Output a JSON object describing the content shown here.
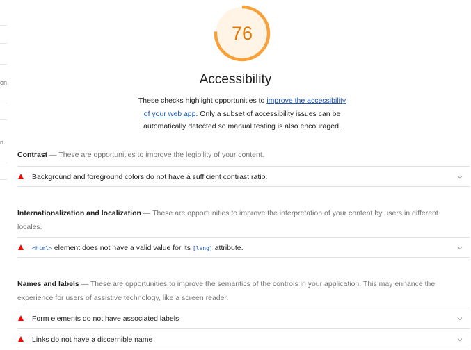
{
  "sidebar": {
    "fragments": [
      "on",
      "n."
    ]
  },
  "score": {
    "value": "76",
    "fraction": 0.76,
    "color": "#e67700"
  },
  "category": {
    "title": "Accessibility",
    "description_before": "These checks highlight opportunities to ",
    "description_link": "improve the accessibility of your web app",
    "description_after": ". Only a subset of accessibility issues can be automatically detected so manual testing is also encouraged."
  },
  "colors": {
    "fail": "#eb0f00",
    "link": "#1a55b8",
    "score": "#e67700"
  },
  "groups": [
    {
      "title": "Contrast",
      "separator": "—",
      "description": "These are opportunities to improve the legibility of your content.",
      "audits": [
        {
          "icon": "fail-triangle-icon",
          "text": "Background and foreground colors do not have a sufficient contrast ratio."
        }
      ]
    },
    {
      "title": "Internationalization and localization",
      "separator": "—",
      "description": "These are opportunities to improve the interpretation of your content by users in different locales.",
      "audits": [
        {
          "icon": "fail-triangle-icon",
          "code1": "<html>",
          "text_mid": " element does not have a valid value for its ",
          "code2": "[lang]",
          "text_end": " attribute."
        }
      ]
    },
    {
      "title": "Names and labels",
      "separator": "—",
      "description": "These are opportunities to improve the semantics of the controls in your application. This may enhance the experience for users of assistive technology, like a screen reader.",
      "audits": [
        {
          "icon": "fail-triangle-icon",
          "text": "Form elements do not have associated labels"
        },
        {
          "icon": "fail-triangle-icon",
          "text": "Links do not have a discernible name"
        }
      ]
    }
  ]
}
